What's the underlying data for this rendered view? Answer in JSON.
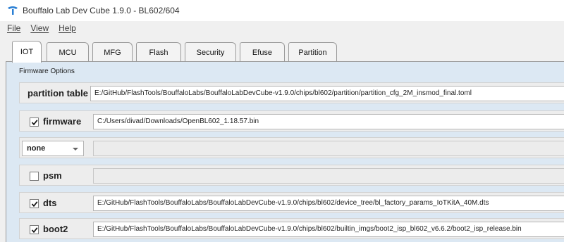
{
  "window": {
    "title": "Bouffalo Lab Dev Cube 1.9.0 - BL602/604",
    "icon": "bouffalo-logo-icon"
  },
  "menu": {
    "items": [
      {
        "label": "File"
      },
      {
        "label": "View"
      },
      {
        "label": "Help"
      }
    ]
  },
  "tabs": [
    {
      "label": "IOT",
      "active": true
    },
    {
      "label": "MCU"
    },
    {
      "label": "MFG"
    },
    {
      "label": "Flash"
    },
    {
      "label": "Security"
    },
    {
      "label": "Efuse"
    },
    {
      "label": "Partition"
    }
  ],
  "firmware_options": {
    "group_title": "Firmware Options",
    "partition_table": {
      "label": "partition table",
      "value": "E:/GitHub/FlashTools/BouffaloLabs/BouffaloLabDevCube-v1.9.0/chips/bl602/partition/partition_cfg_2M_insmod_final.toml"
    },
    "firmware": {
      "label": "firmware",
      "checked": true,
      "value": "C:/Users/divad/Downloads/OpenBL602_1.18.57.bin"
    },
    "media": {
      "selected": "none",
      "value": ""
    },
    "psm": {
      "label": "psm",
      "checked": false,
      "value": ""
    },
    "dts": {
      "label": "dts",
      "checked": true,
      "value": "E:/GitHub/FlashTools/BouffaloLabs/BouffaloLabDevCube-v1.9.0/chips/bl602/device_tree/bl_factory_params_IoTKitA_40M.dts"
    },
    "boot2": {
      "label": "boot2",
      "checked": true,
      "value": "E:/GitHub/FlashTools/BouffaloLabs/BouffaloLabDevCube-v1.9.0/chips/bl602/builtin_imgs/boot2_isp_bl602_v6.6.2/boot2_isp_release.bin"
    }
  },
  "colors": {
    "panel_background": "#dce8f3",
    "row_background": "#ededed",
    "logo_blue": "#2a7fd4"
  }
}
